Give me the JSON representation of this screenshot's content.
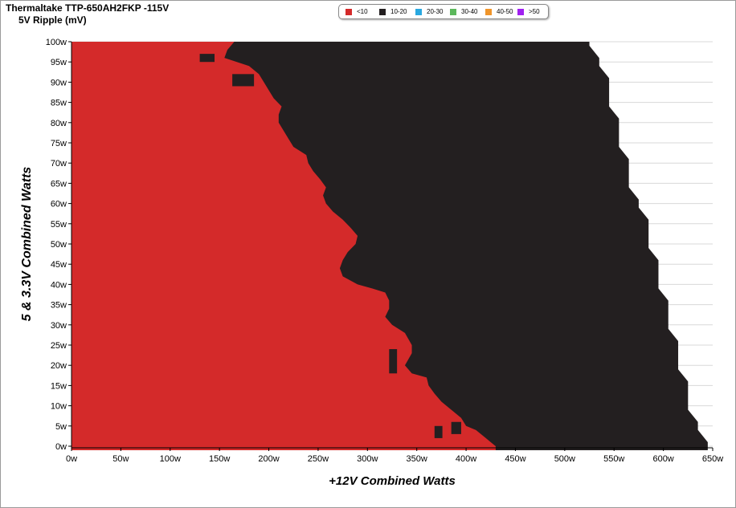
{
  "window": {
    "title": "Thermaltake TTP-650AH2FKP -115V",
    "subtitle": "5V Ripple (mV)"
  },
  "legend": [
    {
      "label": "<10",
      "color": "#d42a2a"
    },
    {
      "label": "10-20",
      "color": "#231f20"
    },
    {
      "label": "20-30",
      "color": "#29a8e0"
    },
    {
      "label": "30-40",
      "color": "#5cb85c"
    },
    {
      "label": "40-50",
      "color": "#f0952a"
    },
    {
      "label": ">50",
      "color": "#a020f0"
    }
  ],
  "colors": {
    "under_10": "#d42a2a",
    "from_10_to_20": "#231f20",
    "gridline": "#d8d8d8",
    "axis": "#000000"
  },
  "chart_data": {
    "type": "heatmap",
    "title": "Thermaltake TTP-650AH2FKP -115V",
    "subtitle": "5V Ripple (mV)",
    "xlabel": "+12V Combined Watts",
    "ylabel": "5 & 3.3V Combined Watts",
    "x_ticks": [
      "0w",
      "50w",
      "100w",
      "150w",
      "200w",
      "250w",
      "300w",
      "350w",
      "400w",
      "450w",
      "500w",
      "550w",
      "600w",
      "650w"
    ],
    "y_ticks": [
      "0w",
      "5w",
      "10w",
      "15w",
      "20w",
      "25w",
      "30w",
      "35w",
      "40w",
      "45w",
      "50w",
      "55w",
      "60w",
      "65w",
      "70w",
      "75w",
      "80w",
      "85w",
      "90w",
      "95w",
      "100w"
    ],
    "xlim": [
      0,
      650
    ],
    "ylim": [
      0,
      100
    ],
    "grid": true,
    "legend_position": "top",
    "max_12v_by_5v": [
      {
        "y": 0,
        "x_max": 645
      },
      {
        "y": 5,
        "x_max": 635
      },
      {
        "y": 10,
        "x_max": 625
      },
      {
        "y": 15,
        "x_max": 625
      },
      {
        "y": 20,
        "x_max": 615
      },
      {
        "y": 25,
        "x_max": 615
      },
      {
        "y": 30,
        "x_max": 605
      },
      {
        "y": 35,
        "x_max": 605
      },
      {
        "y": 40,
        "x_max": 595
      },
      {
        "y": 45,
        "x_max": 595
      },
      {
        "y": 50,
        "x_max": 585
      },
      {
        "y": 55,
        "x_max": 585
      },
      {
        "y": 60,
        "x_max": 575
      },
      {
        "y": 65,
        "x_max": 565
      },
      {
        "y": 70,
        "x_max": 565
      },
      {
        "y": 75,
        "x_max": 555
      },
      {
        "y": 80,
        "x_max": 555
      },
      {
        "y": 85,
        "x_max": 545
      },
      {
        "y": 90,
        "x_max": 545
      },
      {
        "y": 95,
        "x_max": 535
      },
      {
        "y": 100,
        "x_max": 525
      }
    ],
    "boundary_under10_to_10_20": [
      {
        "y": 0,
        "x": 430
      },
      {
        "y": 1,
        "x": 425
      },
      {
        "y": 2,
        "x": 420
      },
      {
        "y": 3,
        "x": 415
      },
      {
        "y": 4,
        "x": 410
      },
      {
        "y": 5,
        "x": 400
      },
      {
        "y": 7,
        "x": 395
      },
      {
        "y": 9,
        "x": 385
      },
      {
        "y": 11,
        "x": 375
      },
      {
        "y": 13,
        "x": 368
      },
      {
        "y": 15,
        "x": 362
      },
      {
        "y": 17,
        "x": 360
      },
      {
        "y": 18,
        "x": 345
      },
      {
        "y": 20,
        "x": 338
      },
      {
        "y": 23,
        "x": 345
      },
      {
        "y": 25,
        "x": 345
      },
      {
        "y": 28,
        "x": 338
      },
      {
        "y": 30,
        "x": 325
      },
      {
        "y": 32,
        "x": 318
      },
      {
        "y": 34,
        "x": 322
      },
      {
        "y": 36,
        "x": 322
      },
      {
        "y": 38,
        "x": 318
      },
      {
        "y": 39,
        "x": 305
      },
      {
        "y": 40,
        "x": 290
      },
      {
        "y": 42,
        "x": 275
      },
      {
        "y": 44,
        "x": 272
      },
      {
        "y": 46,
        "x": 275
      },
      {
        "y": 48,
        "x": 280
      },
      {
        "y": 50,
        "x": 288
      },
      {
        "y": 52,
        "x": 290
      },
      {
        "y": 54,
        "x": 283
      },
      {
        "y": 56,
        "x": 275
      },
      {
        "y": 58,
        "x": 265
      },
      {
        "y": 60,
        "x": 258
      },
      {
        "y": 62,
        "x": 255
      },
      {
        "y": 64,
        "x": 258
      },
      {
        "y": 66,
        "x": 252
      },
      {
        "y": 68,
        "x": 245
      },
      {
        "y": 70,
        "x": 240
      },
      {
        "y": 72,
        "x": 238
      },
      {
        "y": 74,
        "x": 225
      },
      {
        "y": 76,
        "x": 220
      },
      {
        "y": 78,
        "x": 215
      },
      {
        "y": 80,
        "x": 210
      },
      {
        "y": 82,
        "x": 210
      },
      {
        "y": 84,
        "x": 213
      },
      {
        "y": 86,
        "x": 205
      },
      {
        "y": 88,
        "x": 200
      },
      {
        "y": 90,
        "x": 195
      },
      {
        "y": 92,
        "x": 190
      },
      {
        "y": 94,
        "x": 180
      },
      {
        "y": 96,
        "x": 155
      },
      {
        "y": 98,
        "x": 158
      },
      {
        "y": 100,
        "x": 165
      }
    ],
    "islands_10_20": [
      {
        "x_min": 130,
        "x_max": 145,
        "y_min": 95,
        "y_max": 97
      },
      {
        "x_min": 163,
        "x_max": 185,
        "y_min": 89,
        "y_max": 92
      },
      {
        "x_min": 322,
        "x_max": 330,
        "y_min": 18,
        "y_max": 24
      },
      {
        "x_min": 368,
        "x_max": 376,
        "y_min": 2,
        "y_max": 5
      },
      {
        "x_min": 385,
        "x_max": 395,
        "y_min": 3,
        "y_max": 6
      }
    ]
  }
}
